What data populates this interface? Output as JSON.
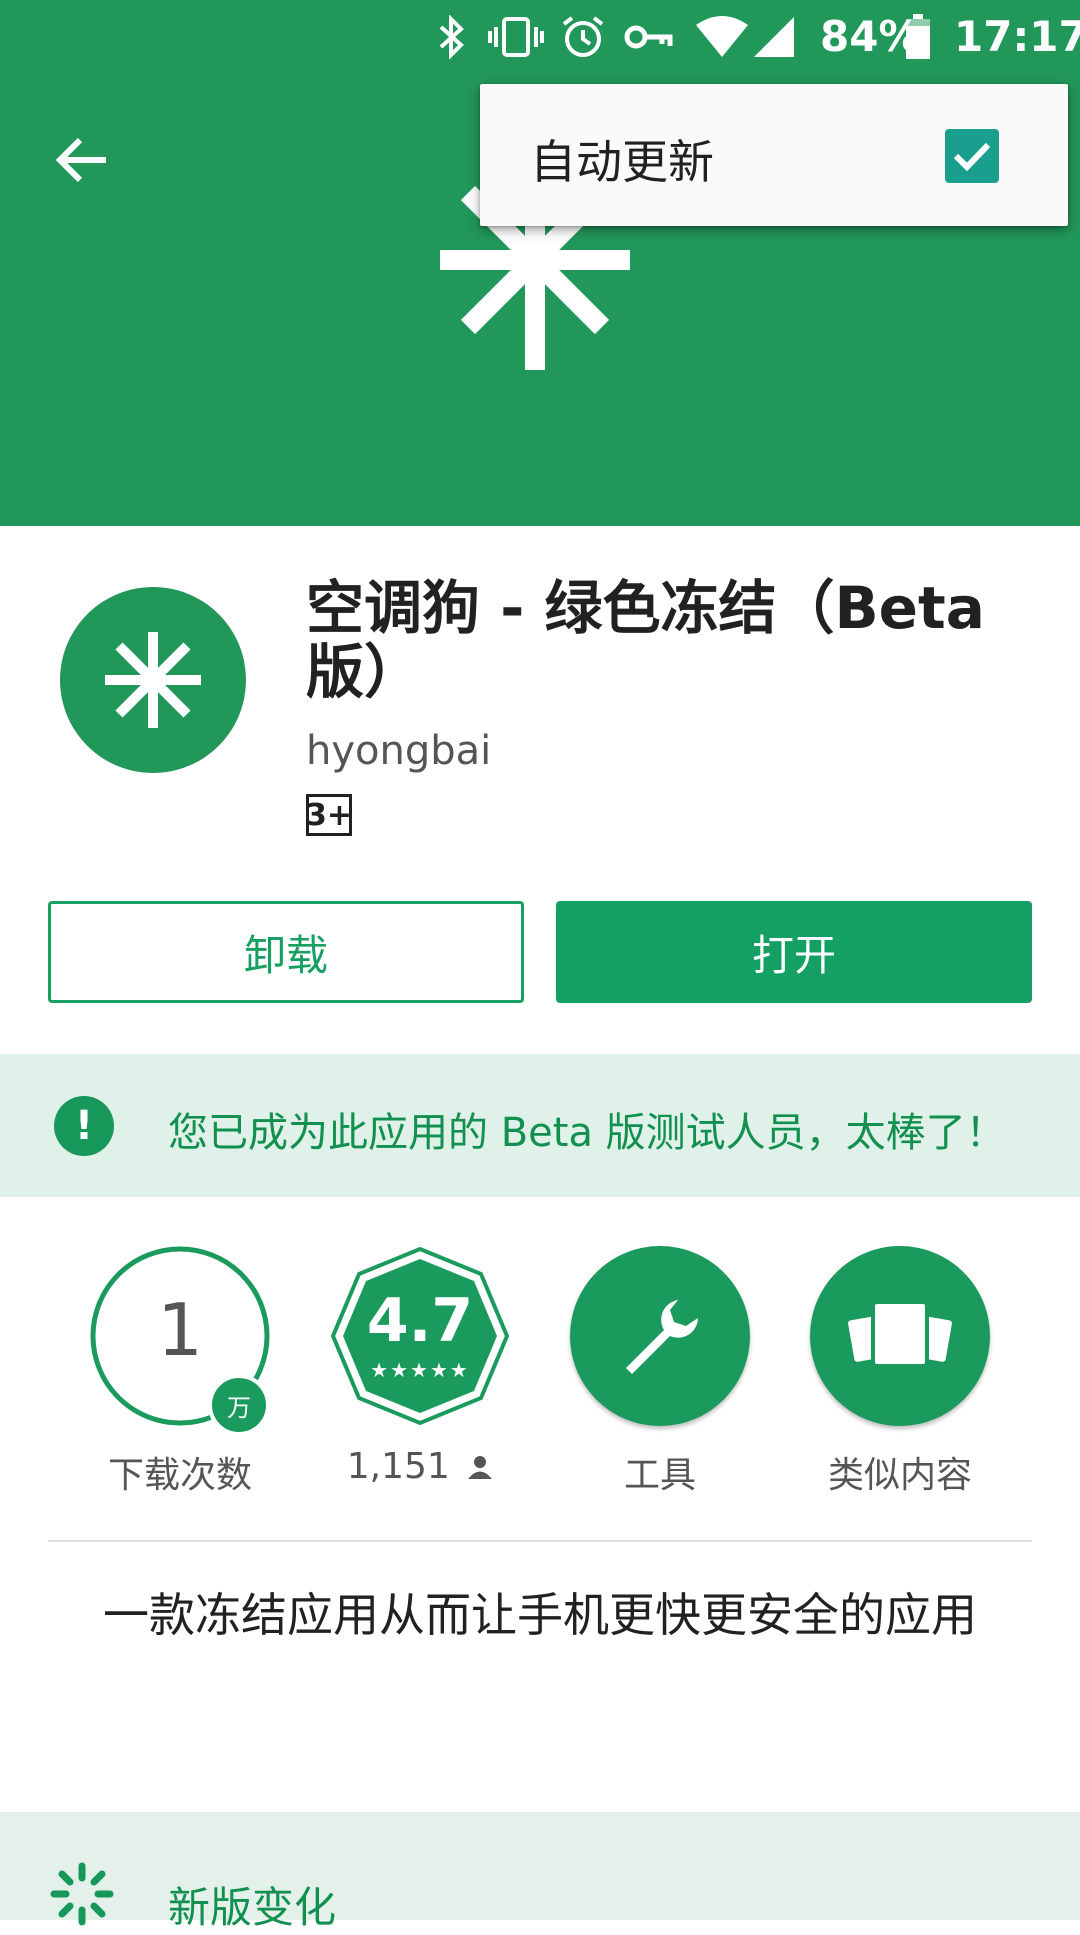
{
  "status_bar": {
    "battery": "84%",
    "time": "17:17",
    "icons": [
      "bluetooth-icon",
      "vibrate-icon",
      "alarm-icon",
      "vpn-key-icon",
      "wifi-icon",
      "signal-icon",
      "battery-icon"
    ]
  },
  "header": {
    "back_icon": "arrow-left-icon"
  },
  "popup_menu": {
    "auto_update_label": "自动更新",
    "auto_update_checked": true
  },
  "app": {
    "title": "空调狗 - 绿色冻结（Beta版）",
    "developer": "hyongbai",
    "age_rating": "3+"
  },
  "actions": {
    "uninstall_label": "卸载",
    "open_label": "打开"
  },
  "beta_banner": {
    "text": "您已成为此应用的 Beta 版测试人员，太棒了！"
  },
  "stats": {
    "downloads_value": "1",
    "downloads_unit": "万",
    "downloads_label": "下载次数",
    "rating_value": "4.7",
    "rating_count": "1,151",
    "category_label": "工具",
    "similar_label": "类似内容"
  },
  "description": "一款冻结应用从而让手机更快更安全的应用",
  "whats_new": {
    "title": "新版变化"
  },
  "colors": {
    "brand_green": "#22975a",
    "accent_green": "#14a062",
    "banner_bg": "#dff1e8"
  }
}
